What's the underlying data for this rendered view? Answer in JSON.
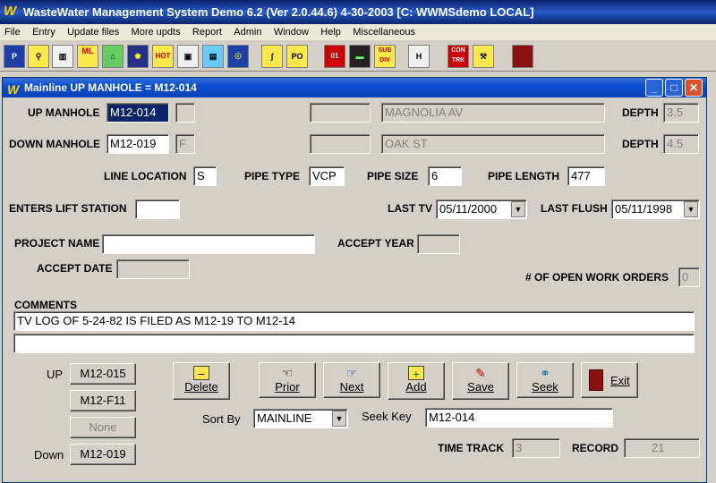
{
  "app": {
    "title": "WasteWater Management System Demo 6.2  (Ver 2.0.44.6)   4-30-2003   [C:  WWMSdemo  LOCAL]"
  },
  "menu": [
    "File",
    "Entry",
    "Update files",
    "More updts",
    "Report",
    "Admin",
    "Window",
    "Help",
    "Miscellaneous"
  ],
  "toolbar": {
    "icons": [
      "p-icon",
      "search-icon",
      "trash-icon",
      "ml-icon",
      "house-icon",
      "map-icon",
      "hot-icon",
      "camera-icon",
      "building-icon",
      "bulb-icon",
      "pipe-icon",
      "po-icon",
      "code-icon",
      "display-icon",
      "subdiv-icon",
      "h-icon",
      "con-trk-icon",
      "tools-icon",
      "exit-door-icon"
    ],
    "labels": {
      "ml": "ML",
      "hot": "HOT",
      "sub": "SUB\nDIV",
      "con": "CON\nTRK",
      "p": "P",
      "po": "PO",
      "h": "H"
    }
  },
  "window": {
    "title": "Mainline UP MANHOLE = M12-014"
  },
  "form": {
    "up_manhole_label": "UP MANHOLE",
    "up_manhole": "M12-014",
    "up_manhole_ext": "",
    "up_code": "",
    "up_street": "MAGNOLIA AV",
    "down_manhole_label": "DOWN MANHOLE",
    "down_manhole": "M12-019",
    "down_manhole_ext": "F",
    "down_code": "",
    "down_street": "OAK ST",
    "depth_label": "DEPTH",
    "up_depth": "3.5",
    "down_depth": "4.5",
    "line_location_label": "LINE LOCATION",
    "line_location": "S",
    "pipe_type_label": "PIPE TYPE",
    "pipe_type": "VCP",
    "pipe_size_label": "PIPE SIZE",
    "pipe_size": "6",
    "pipe_length_label": "PIPE LENGTH",
    "pipe_length": "477",
    "enters_lift_label": "ENTERS LIFT STATION",
    "enters_lift": "",
    "last_tv_label": "LAST TV",
    "last_tv": "05/11/2000",
    "last_flush_label": "LAST FLUSH",
    "last_flush": "05/11/1998",
    "project_name_label": "PROJECT NAME",
    "project_name": "",
    "accept_year_label": "ACCEPT YEAR",
    "accept_year": "",
    "accept_date_label": "ACCEPT DATE",
    "accept_date": "",
    "open_wo_label": "# OF OPEN WORK ORDERS",
    "open_wo": "0",
    "comments_label": "COMMENTS",
    "comment1": "TV LOG OF 5-24-82 IS FILED AS M12-19 TO M12-14",
    "comment2": ""
  },
  "links": {
    "up_label": "UP",
    "up1": "M12-015",
    "up2": "M12-F11",
    "none": "None",
    "down_label": "Down",
    "down1": "M12-019"
  },
  "buttons": {
    "delete": "Delete",
    "prior": "Prior",
    "next": "Next",
    "add": "Add",
    "save": "Save",
    "seek": "Seek",
    "exit": "Exit"
  },
  "sort": {
    "label": "Sort By",
    "value": "MAINLINE",
    "seek_key_label": "Seek Key",
    "seek_key": "M12-014"
  },
  "footer": {
    "time_track_label": "TIME TRACK",
    "time_track": "3",
    "record_label": "RECORD",
    "record": "21"
  }
}
